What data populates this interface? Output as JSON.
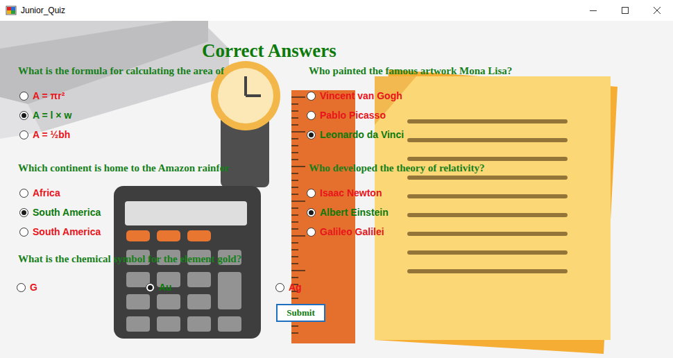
{
  "window": {
    "title": "Junior_Quiz"
  },
  "heading": "Correct Answers",
  "questions": [
    {
      "text": "What is the formula for calculating the area of",
      "options": [
        {
          "label": "A = πr²",
          "selected": false,
          "color": "#e8141b"
        },
        {
          "label": "A = l × w",
          "selected": true,
          "color": "#0b7a0b"
        },
        {
          "label": "A = ½bh",
          "selected": false,
          "color": "#e8141b"
        }
      ]
    },
    {
      "text": "Which continent is home to the Amazon rainfor",
      "options": [
        {
          "label": "Africa",
          "selected": false,
          "color": "#e8141b"
        },
        {
          "label": "South America",
          "selected": true,
          "color": "#0b7a0b"
        },
        {
          "label": "South America",
          "selected": false,
          "color": "#e8141b"
        }
      ]
    },
    {
      "text": "Who painted the famous artwork Mona Lisa?",
      "options": [
        {
          "label": "Vincent van Gogh",
          "selected": false,
          "color": "#e8141b"
        },
        {
          "label": "Pablo Picasso",
          "selected": false,
          "color": "#e8141b"
        },
        {
          "label": "Leonardo da Vinci",
          "selected": true,
          "color": "#0b7a0b"
        }
      ]
    },
    {
      "text": "Who developed the theory of relativity?",
      "options": [
        {
          "label": "Isaac Newton",
          "selected": false,
          "color": "#e8141b"
        },
        {
          "label": "Albert Einstein",
          "selected": true,
          "color": "#0b7a0b"
        },
        {
          "label": "Galileo Galilei",
          "selected": false,
          "color": "#e8141b"
        }
      ]
    },
    {
      "text": "What is the chemical symbol for the element gold?",
      "options": [
        {
          "label": "G",
          "selected": false,
          "color": "#e8141b"
        },
        {
          "label": "Au",
          "selected": true,
          "color": "#0b7a0b"
        },
        {
          "label": "Ag",
          "selected": false,
          "color": "#e8141b"
        }
      ]
    }
  ],
  "submit": "Submit"
}
